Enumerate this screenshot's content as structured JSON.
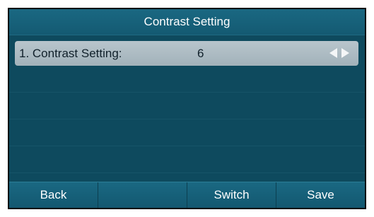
{
  "screen": {
    "title": "Contrast Setting"
  },
  "setting_row": {
    "label": "1. Contrast Setting:",
    "value": "6",
    "left_arrow_icon": "arrow-left-icon",
    "right_arrow_icon": "arrow-right-icon"
  },
  "softkeys": [
    {
      "label": "Back"
    },
    {
      "label": ""
    },
    {
      "label": "Switch"
    },
    {
      "label": "Save"
    }
  ],
  "colors": {
    "background": "#0e4a5e",
    "title_bar": "#1a6882",
    "selected_row": "#b8c5cc",
    "softkey_bar": "#1a6882",
    "text_light": "#ffffff",
    "text_dark": "#10202a"
  }
}
